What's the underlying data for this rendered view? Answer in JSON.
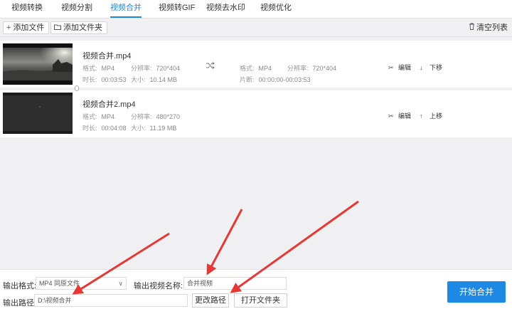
{
  "tabs": [
    "视频转换",
    "视频分割",
    "视频合并",
    "视频转GIF",
    "视频去水印",
    "视频优化"
  ],
  "toolbar": {
    "add_file": "添加文件",
    "add_folder": "添加文件夹",
    "clear_list": "清空列表"
  },
  "items": [
    {
      "name": "视频合并.mp4",
      "format_label": "格式:",
      "format": "MP4",
      "res_label": "分辨率:",
      "res": "720*404",
      "dur_label": "时长:",
      "dur": "00:03:53",
      "size_label": "大小:",
      "size": "10.14 MB",
      "out_format_label": "格式:",
      "out_format": "MP4",
      "out_res_label": "分辨率:",
      "out_res": "720*404",
      "clip_label": "片断:",
      "clip": "00:00:00-00:03:53",
      "edit_label": "编辑",
      "move_label": "下移"
    },
    {
      "name": "视频合并2.mp4",
      "format_label": "格式:",
      "format": "MP4",
      "res_label": "分辨率:",
      "res": "480*270",
      "dur_label": "时长:",
      "dur": "00:04:08",
      "size_label": "大小:",
      "size": "11.19 MB",
      "edit_label": "编辑",
      "move_label": "上移"
    }
  ],
  "bottom": {
    "format_label": "输出格式:",
    "format_value": "MP4  同原文件",
    "name_label": "输出视频名称:",
    "name_value": "合并视频",
    "path_label": "输出路径:",
    "path_value": "D:\\视频合并",
    "change_path": "更改路径",
    "open_folder": "打开文件夹",
    "start": "开始合并"
  },
  "colors": {
    "accent": "#1e88e5",
    "arrow": "#e53935"
  }
}
